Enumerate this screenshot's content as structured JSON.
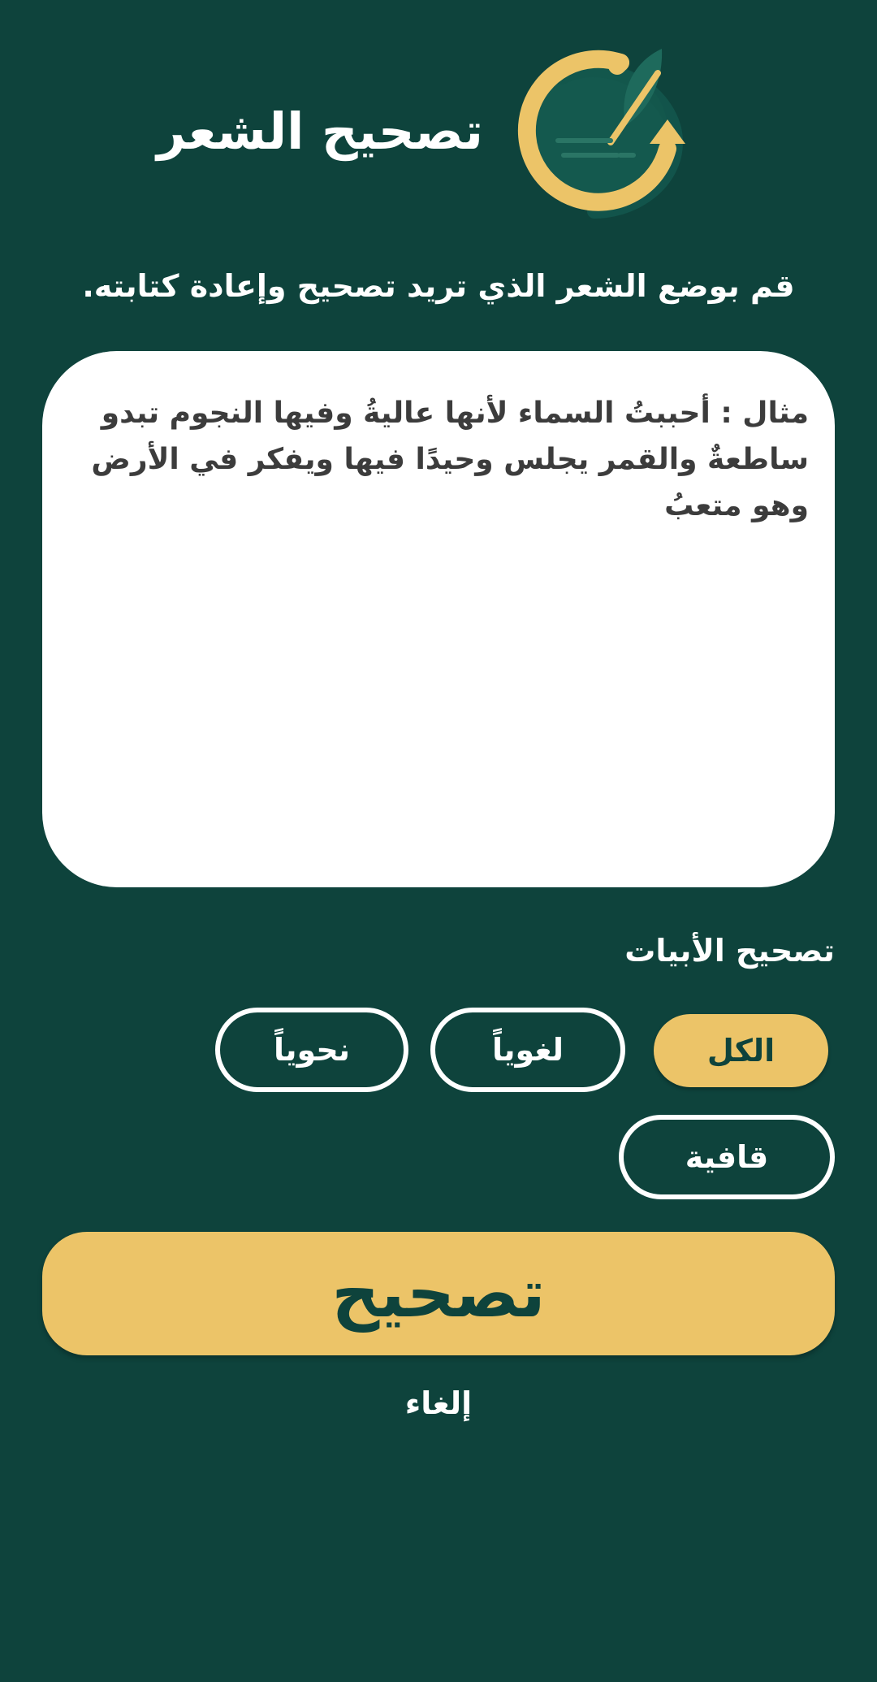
{
  "header": {
    "title": "تصحيح الشعر",
    "logo_icon": "circular-arrow-quill-logo-icon"
  },
  "instruction": "قم بوضع الشعر الذي تريد تصحيح وإعادة كتابته.",
  "poem_input": {
    "value": "",
    "placeholder": "مثال : أحببتُ السماء لأنها عاليةُ وفيها النجوم تبدو ساطعةٌ والقمر يجلس وحيدًا فيها ويفكر في الأرض وهو متعبُ"
  },
  "options": {
    "label": "تصحيح الأبيات",
    "chips": [
      {
        "label": "الكل",
        "selected": true
      },
      {
        "label": "لغوياً",
        "selected": false
      },
      {
        "label": "نحوياً",
        "selected": false
      },
      {
        "label": "قافية",
        "selected": false
      }
    ]
  },
  "actions": {
    "correct_label": "تصحيح",
    "cancel_label": "إلغاء"
  },
  "colors": {
    "background": "#0e433c",
    "accent": "#ecc468",
    "surface": "#ffffff",
    "text_dark": "#3c3c3c"
  }
}
